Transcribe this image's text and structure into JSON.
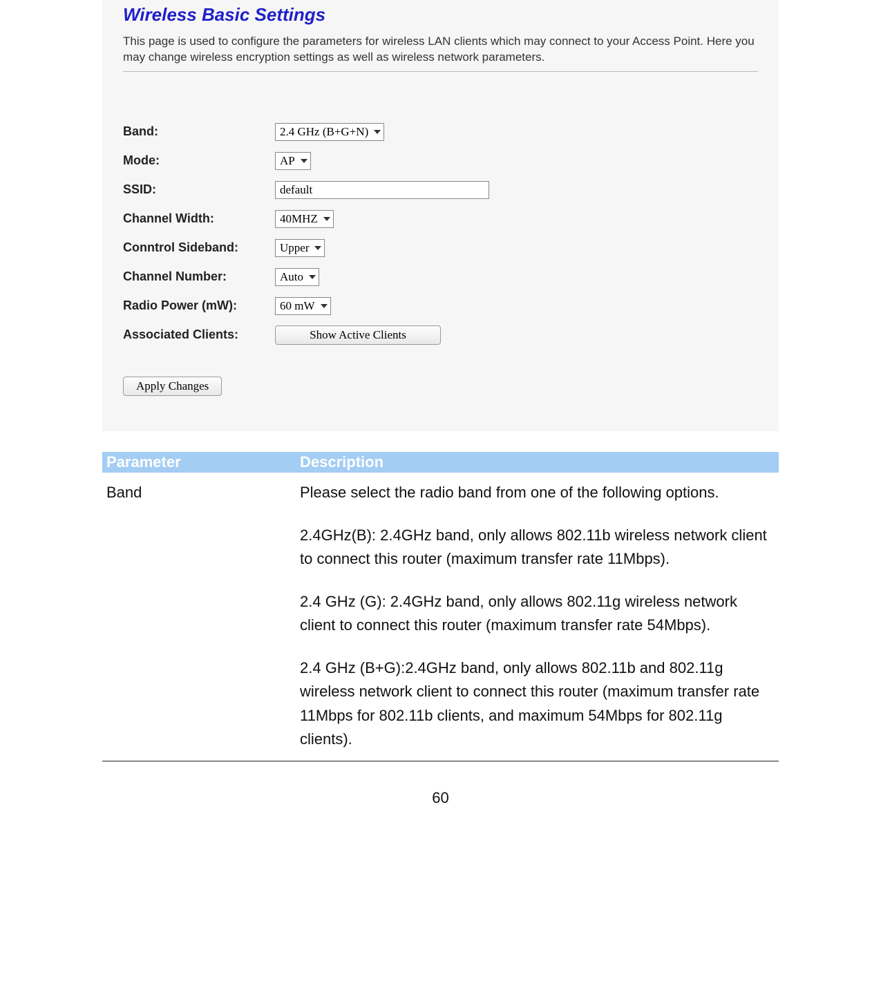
{
  "router": {
    "title": "Wireless Basic Settings",
    "description": "This page is used to configure the parameters for wireless LAN clients which may connect to your Access Point. Here you may change wireless encryption settings as well as wireless network parameters.",
    "fields": {
      "band": {
        "label": "Band:",
        "value": "2.4 GHz (B+G+N)"
      },
      "mode": {
        "label": "Mode:",
        "value": "AP"
      },
      "ssid": {
        "label": "SSID:",
        "value": "default"
      },
      "channel_width": {
        "label": "Channel Width:",
        "value": "40MHZ"
      },
      "control_sideband": {
        "label": "Conntrol Sideband:",
        "value": "Upper"
      },
      "channel_number": {
        "label": "Channel Number:",
        "value": "Auto"
      },
      "radio_power": {
        "label": "Radio Power (mW):",
        "value": "60 mW"
      },
      "associated_clients": {
        "label": "Associated Clients:",
        "button": "Show Active Clients"
      }
    },
    "apply_button": "Apply Changes"
  },
  "param_table": {
    "header": {
      "param": "Parameter",
      "desc": "Description"
    },
    "row": {
      "param": "Band",
      "desc": {
        "p1": "Please select the radio band from one of the following options.",
        "p2": "2.4GHz(B): 2.4GHz band, only allows 802.11b wireless network client to connect this router (maximum transfer rate 11Mbps).",
        "p3": "2.4 GHz (G): 2.4GHz band, only allows 802.11g wireless network client to connect this router (maximum transfer rate 54Mbps).",
        "p4": "2.4 GHz (B+G):2.4GHz band, only allows 802.11b and 802.11g wireless network client to connect this router (maximum transfer rate 11Mbps for 802.11b clients, and maximum 54Mbps for 802.11g clients)."
      }
    }
  },
  "page_number": "60"
}
